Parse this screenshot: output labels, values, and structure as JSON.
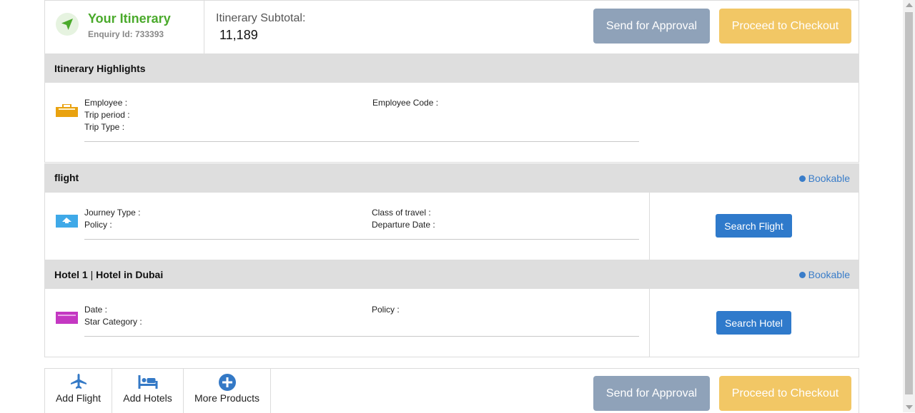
{
  "header": {
    "title": "Your Itinerary",
    "enquiry": "Enquiry Id: 733393",
    "subtotal_label": "Itinerary Subtotal:",
    "subtotal_value": "11,189",
    "send_approval": "Send for Approval",
    "checkout": "Proceed to Checkout"
  },
  "highlights": {
    "title": "Itinerary Highlights",
    "employee": "Employee :",
    "trip_period": "Trip period :",
    "trip_type": "Trip Type :",
    "employee_code": "Employee Code :"
  },
  "flight": {
    "title": "flight",
    "status": "Bookable",
    "journey_type": "Journey Type :",
    "policy": "Policy :",
    "class_of_travel": "Class of travel :",
    "departure_date": "Departure Date :",
    "search_button": "Search Flight"
  },
  "hotel": {
    "title_prefix": "Hotel 1",
    "title_sep": " | ",
    "title_suffix": "Hotel in Dubai",
    "status": "Bookable",
    "date": "Date :",
    "star_category": "Star Category :",
    "policy": "Policy :",
    "search_button": "Search Hotel"
  },
  "footer": {
    "add_flight": "Add Flight",
    "add_hotels": "Add Hotels",
    "more_products": "More Products",
    "send_approval": "Send for Approval",
    "checkout": "Proceed to Checkout"
  },
  "colors": {
    "green": "#4aaa2b",
    "blue": "#2f7acb",
    "approval": "#8fa2b9",
    "checkout": "#f2c765",
    "band": "#dedede"
  },
  "icons": {
    "header": "navigation-arrow-icon",
    "highlights": "suitcase-icon",
    "flight": "flight-ticket-icon",
    "hotel": "hotel-bed-icon",
    "add_flight": "airplane-icon",
    "add_hotels": "bed-icon",
    "more_products": "plus-circle-icon"
  }
}
